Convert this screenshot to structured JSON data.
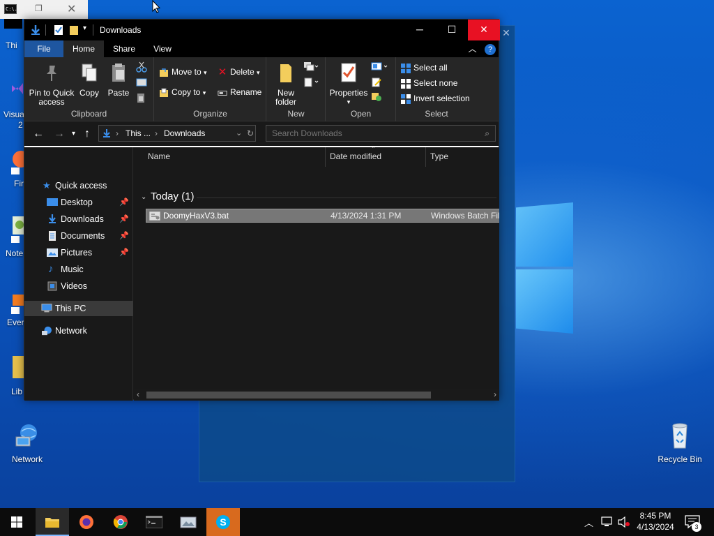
{
  "cmd_window": {
    "icon_text": "C:\\."
  },
  "desktop": {
    "icons": [
      {
        "id": "network",
        "label": "Network"
      },
      {
        "id": "recycle-bin",
        "label": "Recycle Bin"
      }
    ],
    "partial_labels": [
      "Thi",
      "Visua",
      "2",
      "Fir",
      "Note",
      "Ever",
      "Lib"
    ]
  },
  "explorer": {
    "title": "Downloads",
    "tabs": [
      {
        "label": "File"
      },
      {
        "label": "Home"
      },
      {
        "label": "Share"
      },
      {
        "label": "View"
      }
    ],
    "ribbon": {
      "clipboard": {
        "label": "Clipboard",
        "pin_label_1": "Pin to Quick",
        "pin_label_2": "access",
        "copy": "Copy",
        "paste": "Paste"
      },
      "organize": {
        "label": "Organize",
        "move_to": "Move to",
        "copy_to": "Copy to",
        "delete": "Delete",
        "rename": "Rename"
      },
      "new": {
        "label": "New",
        "new_folder_1": "New",
        "new_folder_2": "folder"
      },
      "open": {
        "label": "Open",
        "properties": "Properties"
      },
      "select": {
        "label": "Select",
        "select_all": "Select all",
        "select_none": "Select none",
        "invert": "Invert selection"
      }
    },
    "address": {
      "crumb1": "This ...",
      "crumb2": "Downloads",
      "search_placeholder": "Search Downloads"
    },
    "nav": [
      {
        "label": "Quick access",
        "pinned": false
      },
      {
        "label": "Desktop",
        "pinned": true
      },
      {
        "label": "Downloads",
        "pinned": true
      },
      {
        "label": "Documents",
        "pinned": true
      },
      {
        "label": "Pictures",
        "pinned": true
      },
      {
        "label": "Music",
        "pinned": false
      },
      {
        "label": "Videos",
        "pinned": false
      },
      {
        "label": "This PC",
        "pinned": false,
        "selected": true
      },
      {
        "label": "Network",
        "pinned": false
      }
    ],
    "columns": {
      "name": "Name",
      "date": "Date modified",
      "type": "Type"
    },
    "group": "Today (1)",
    "files": [
      {
        "name": "DoomyHaxV3.bat",
        "date": "4/13/2024 1:31 PM",
        "type": "Windows Batch File"
      }
    ]
  },
  "taskbar": {
    "apps": [
      "file-explorer",
      "firefox",
      "chrome",
      "terminal",
      "photos",
      "skype"
    ],
    "clock": {
      "time": "8:45 PM",
      "date": "4/13/2024"
    },
    "notification_count": "3"
  }
}
